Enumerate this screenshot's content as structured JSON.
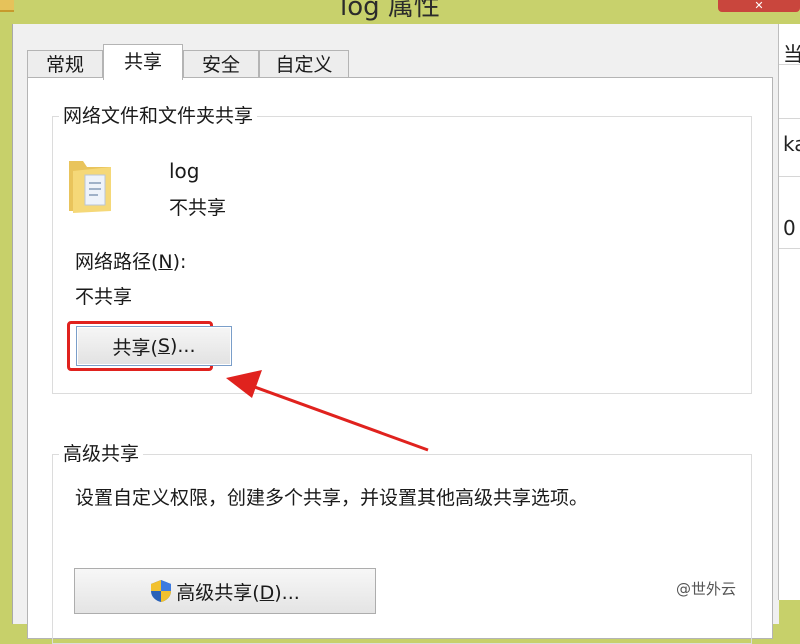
{
  "window": {
    "title": "log 属性",
    "close_label": "✕"
  },
  "tabs": [
    {
      "label": "常规"
    },
    {
      "label": "共享"
    },
    {
      "label": "安全"
    },
    {
      "label": "自定义"
    }
  ],
  "network_share": {
    "group_title": "网络文件和文件夹共享",
    "folder_name": "log",
    "folder_status": "不共享",
    "path_label_prefix": "网络路径(",
    "path_label_key": "N",
    "path_label_suffix": "):",
    "path_value": "不共享",
    "share_button_prefix": "共享(",
    "share_button_key": "S",
    "share_button_suffix": ")..."
  },
  "advanced_share": {
    "group_title": "高级共享",
    "description": "设置自定义权限，创建多个共享，并设置其他高级共享选项。",
    "button_prefix": "高级共享(",
    "button_key": "D",
    "button_suffix": ")..."
  },
  "background_window": {
    "fragments": [
      "当",
      "ka",
      "0"
    ]
  },
  "watermark": "@世外云",
  "colors": {
    "highlight_red": "#e0221e",
    "desktop_bg": "#c7d06a",
    "folder_yellow": "#f3d26a"
  }
}
